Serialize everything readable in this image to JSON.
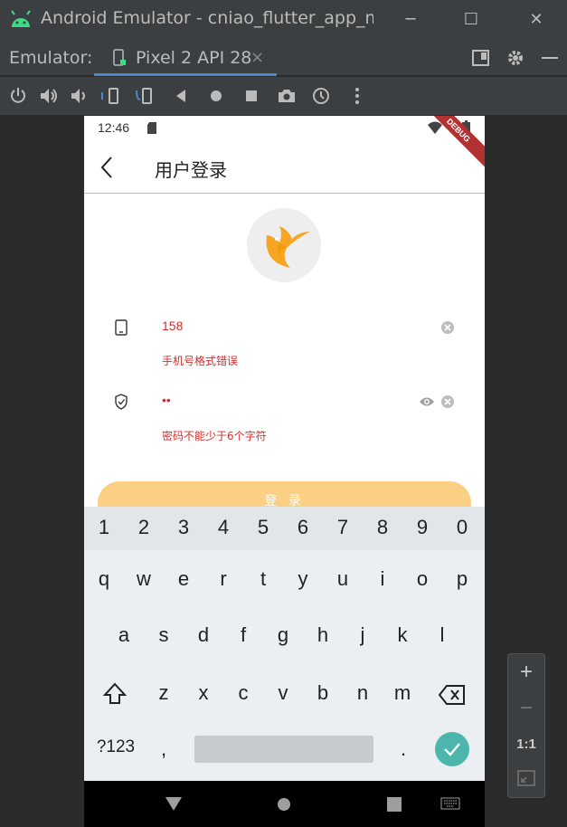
{
  "window": {
    "title": "Android Emulator - cniao_flutter_app_my_f",
    "minimize": "─",
    "maximize": "☐",
    "close": "✕"
  },
  "tabbar": {
    "label": "Emulator:",
    "tab_label": "Pixel 2 API 28",
    "tab_close": "×"
  },
  "toolbar": {
    "icons": [
      "power-icon",
      "volume-up-icon",
      "volume-down-icon",
      "rotate-left-icon",
      "rotate-right-icon",
      "back-icon",
      "home-icon",
      "overview-icon",
      "screenshot-icon",
      "snapshot-icon",
      "more-icon"
    ]
  },
  "phone": {
    "status": {
      "time": "12:46",
      "debug": "DEBUG"
    },
    "appbar": {
      "title": "用户登录"
    },
    "phone_field": {
      "value": "158",
      "error": "手机号格式错误"
    },
    "password_field": {
      "value": "••",
      "error": "密码不能少于6个字符"
    },
    "login_button": "登 录"
  },
  "keyboard": {
    "numbers": [
      "1",
      "2",
      "3",
      "4",
      "5",
      "6",
      "7",
      "8",
      "9",
      "0"
    ],
    "row1": [
      "q",
      "w",
      "e",
      "r",
      "t",
      "y",
      "u",
      "i",
      "o",
      "p"
    ],
    "row2": [
      "a",
      "s",
      "d",
      "f",
      "g",
      "h",
      "j",
      "k",
      "l"
    ],
    "row3": [
      "z",
      "x",
      "c",
      "v",
      "b",
      "n",
      "m"
    ],
    "symbols_key": "?123",
    "comma": ",",
    "period": "."
  },
  "side_panel": {
    "zoom_in": "+",
    "zoom_out": "−",
    "one_to_one": "1:1"
  },
  "colors": {
    "accent": "#4a88c7",
    "error": "#d32f2f",
    "button": "#fbcf84",
    "enter": "#4db6ac",
    "debug_banner": "#b23131"
  }
}
